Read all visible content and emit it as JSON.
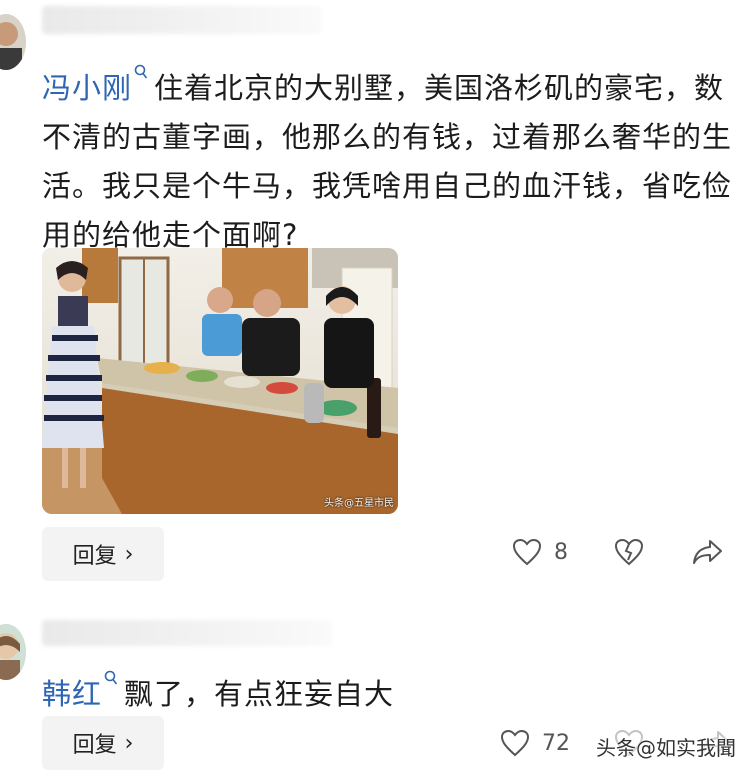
{
  "comments": [
    {
      "author": "冯小刚",
      "verify_icon": "search-badge-icon",
      "text": "住着北京的大别墅，美国洛杉矶的豪宅，数不清的古董字画，他那么的有钱，过着那么奢华的生活。我只是个牛马，我凭啥用自己的血汗钱，省吃俭用的给他走个面啊?",
      "photo_caption": "头条@五星市民",
      "reply_label": "回复",
      "reply_chevron": "›",
      "like_count": "8"
    },
    {
      "author": "韩红",
      "verify_icon": "search-badge-icon",
      "text": "飘了，有点狂妄自大",
      "reply_label": "回复",
      "reply_chevron": "›",
      "like_count": "72"
    }
  ],
  "watermark": "头条@如实我聞",
  "icons": {
    "like": "heart-outline-icon",
    "dislike": "broken-heart-icon",
    "share": "share-arrow-icon"
  },
  "colors": {
    "author": "#2f66b3",
    "button_bg": "#f3f3f3",
    "icon": "#555555"
  }
}
